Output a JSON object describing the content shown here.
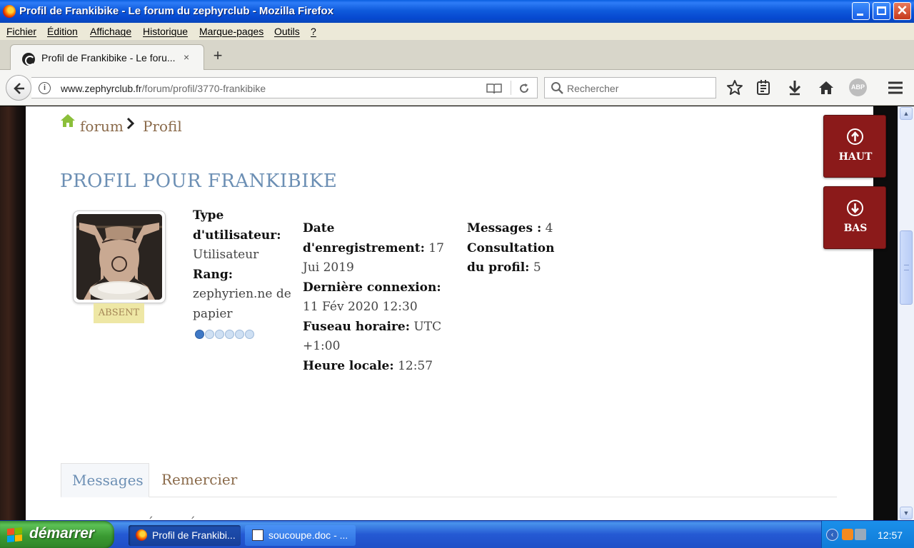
{
  "window": {
    "title": "Profil de Frankibike - Le forum du zephyrclub - Mozilla Firefox",
    "close_glyph": "✕"
  },
  "menu": [
    "Fichier",
    "Édition",
    "Affichage",
    "Historique",
    "Marque-pages",
    "Outils",
    "?"
  ],
  "browser_tab": {
    "label": "Profil de Frankibike - Le foru...",
    "close_glyph": "×",
    "new_tab_glyph": "+"
  },
  "address_bar": {
    "host": "www.zephyrclub.fr",
    "path": "/forum/profil/3770-frankibike",
    "info_glyph": "i"
  },
  "search": {
    "placeholder": "Rechercher"
  },
  "toolbar": {
    "adblock_label": "ABP"
  },
  "breadcrumb": {
    "home": "forum",
    "current": "Profil"
  },
  "profile": {
    "title": "PROFIL POUR FRANKIBIKE",
    "status": "ABSENT",
    "user_type_label": "Type d'utilisateur:",
    "user_type_value": "Utilisateur",
    "rank_label": "Rang:",
    "rank_value": "zephyrien.ne de papier",
    "rank_level": 1,
    "rank_max": 6,
    "registered_label": "Date d'enregistrement:",
    "registered_value": "17 Jui 2019",
    "last_login_label": "Dernière connexion:",
    "last_login_value": "11 Fév 2020 12:30",
    "timezone_label": "Fuseau horaire:",
    "timezone_value": "UTC +1:00",
    "local_time_label": "Heure locale:",
    "local_time_value": "12:57",
    "messages_label": "Messages :",
    "messages_value": "4",
    "views_label": "Consultation du profil:",
    "views_value": "5"
  },
  "profile_tabs": {
    "messages": "Messages",
    "thanks": "Remercier"
  },
  "overflow_text": "´ ´",
  "floating": {
    "up": "HAUT",
    "down": "BAS"
  },
  "scrollbar": {
    "up_glyph": "▲",
    "down_glyph": "▼"
  },
  "taskbar": {
    "start": "démarrer",
    "tasks": [
      "Profil de Frankibi...",
      "soucoupe.doc - ..."
    ],
    "tray_glyph": "‹",
    "clock": "12:57"
  },
  "colors": {
    "accent_red": "#8b1a1a",
    "title_blue": "#6c8fb4",
    "link_brown": "#8a6a4a",
    "status_yellow": "#eee7a5",
    "home_green": "#8bbf3a"
  }
}
